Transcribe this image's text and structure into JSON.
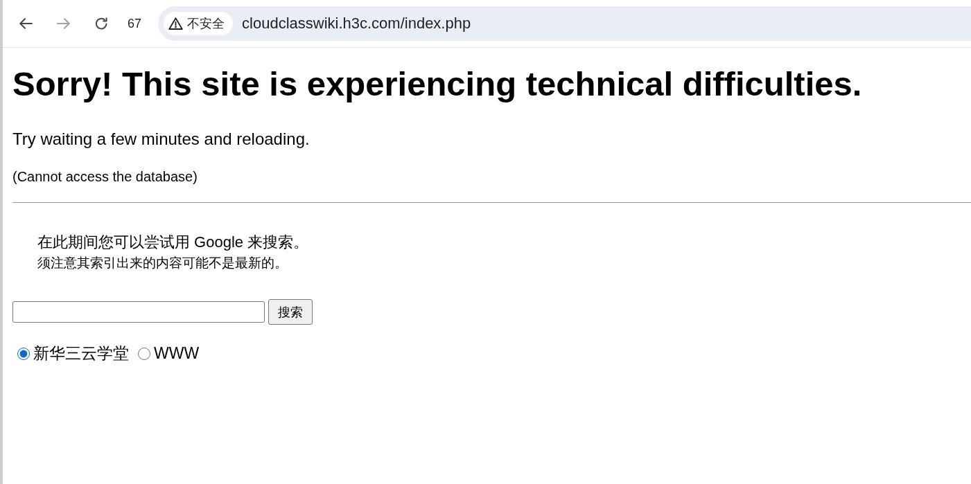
{
  "browser_toolbar": {
    "nav_buttons": [
      {
        "kind": "back",
        "disabled": false
      },
      {
        "kind": "forward",
        "disabled": true
      },
      {
        "kind": "reload",
        "disabled": false
      }
    ],
    "counter": "67",
    "security_chip": {
      "label": "不安全"
    },
    "url": "cloudclasswiki.h3c.com/index.php"
  },
  "page": {
    "heading": "Sorry! This site is experiencing technical difficulties.",
    "message": "Try waiting a few minutes and reloading.",
    "detail": "(Cannot access the database)",
    "search_notice": {
      "line_1": "在此期间您可以尝试用 Google 来搜索。",
      "line_2": "须注意其索引出来的内容可能不是最新的。"
    },
    "search_button": "搜索",
    "radio_options": [
      {
        "label": "新华三云学堂",
        "selected": true
      },
      {
        "label": "WWW",
        "selected": false
      }
    ]
  }
}
